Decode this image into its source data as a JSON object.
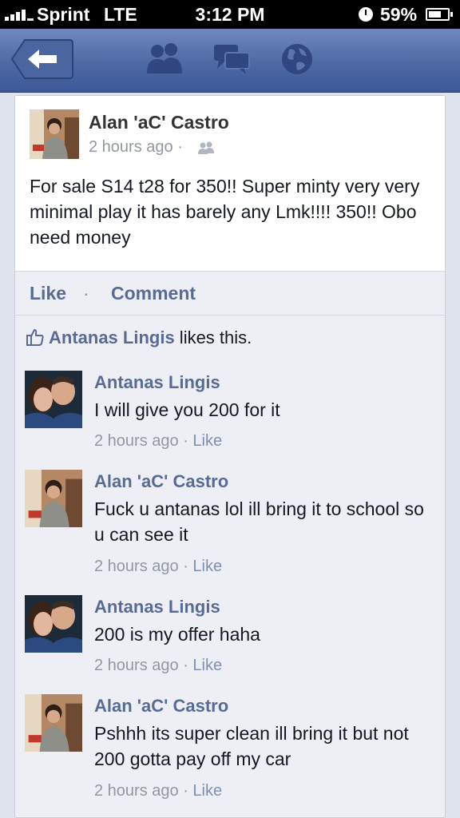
{
  "status_bar": {
    "carrier": "Sprint",
    "network": "LTE",
    "time": "3:12 PM",
    "battery": "59%"
  },
  "nav": {
    "icons": [
      "back-arrow-icon",
      "friends-icon",
      "messages-icon",
      "globe-icon"
    ]
  },
  "post": {
    "author": "Alan 'aC' Castro",
    "time": "2 hours ago",
    "separator": "·",
    "text": "For sale S14 t28 for 350!! Super minty very very minimal play it has barely any Lmk!!!! 350!! Obo need money",
    "actions": {
      "like": "Like",
      "separator": "·",
      "comment": "Comment"
    },
    "likes": {
      "liker": "Antanas Lingis",
      "suffix": " likes this."
    }
  },
  "comments": [
    {
      "author": "Antanas Lingis",
      "text": "I will give you 200 for it",
      "time": "2 hours ago",
      "sep": " · ",
      "like": "Like"
    },
    {
      "author": "Alan 'aC' Castro",
      "text": "Fuck u antanas lol ill bring it to school so u can see it",
      "time": "2 hours ago",
      "sep": " · ",
      "like": "Like"
    },
    {
      "author": "Antanas Lingis",
      "text": "200 is my offer haha",
      "time": "2 hours ago",
      "sep": " · ",
      "like": "Like"
    },
    {
      "author": "Alan 'aC' Castro",
      "text": "Pshhh its super clean ill bring it but not 200 gotta pay off my car",
      "time": "2 hours ago",
      "sep": " · ",
      "like": "Like"
    }
  ],
  "colors": {
    "nav_blue": "#4e69a4",
    "link_blue": "#576b95",
    "meta_gray": "#9197a3"
  }
}
